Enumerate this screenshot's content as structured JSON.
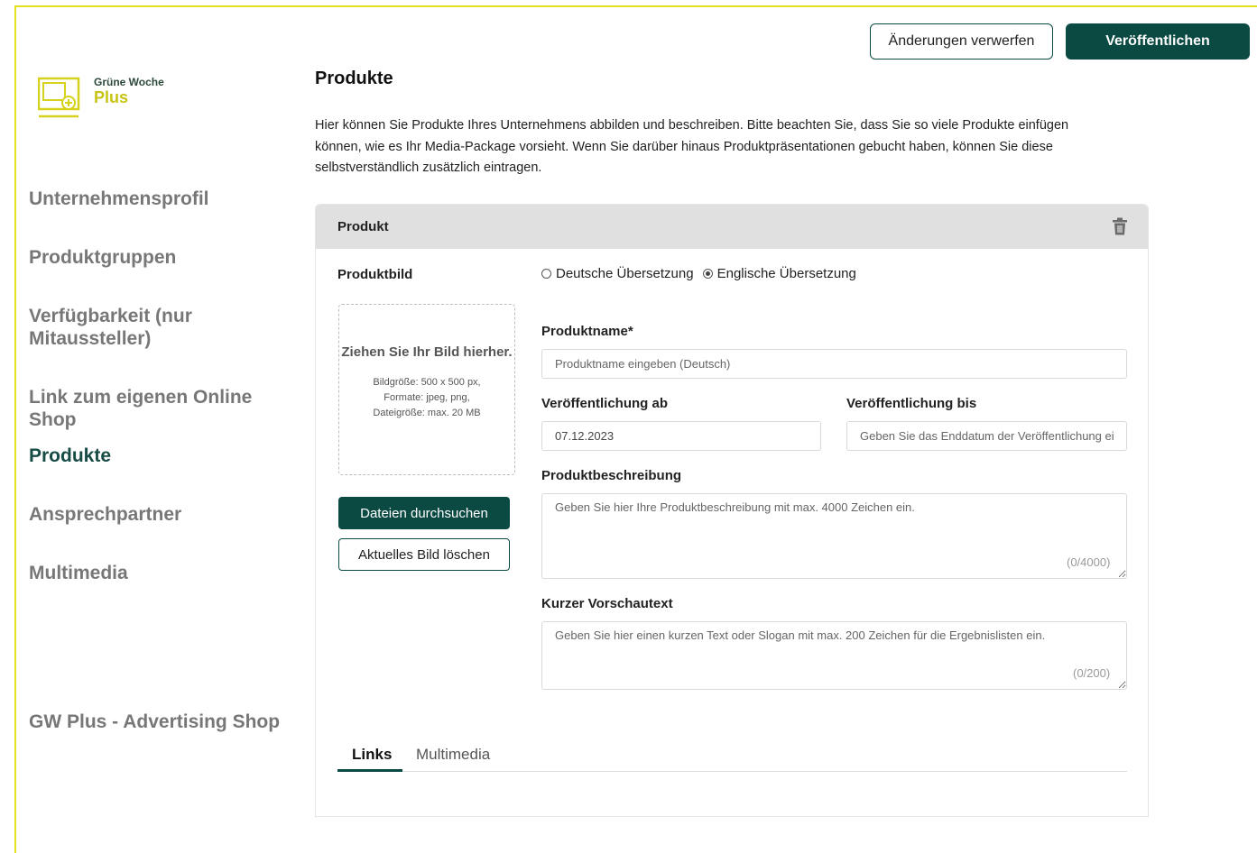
{
  "header": {
    "discard_label": "Änderungen verwerfen",
    "publish_label": "Veröffentlichen"
  },
  "logo": {
    "line1": "Grüne Woche",
    "line2": "Plus"
  },
  "sidebar": {
    "items": [
      {
        "label": "Unternehmensprofil"
      },
      {
        "label": "Produktgruppen"
      },
      {
        "label": "Verfügbarkeit (nur Mitaussteller)"
      },
      {
        "label": "Link zum eigenen Online Shop"
      },
      {
        "label": "Produkte"
      },
      {
        "label": "Ansprechpartner"
      },
      {
        "label": "Multimedia"
      }
    ],
    "active": "Produkte",
    "shop_link": "GW Plus - Advertising Shop"
  },
  "main": {
    "title": "Produkte",
    "intro": "Hier können Sie Produkte Ihres Unternehmens abbilden und beschreiben. Bitte beachten Sie, dass Sie so viele Produkte einfügen können, wie es Ihr Media-Package vorsieht. Wenn Sie darüber hinaus Produktpräsentationen gebucht haben, können Sie diese selbstverständlich zusätzlich eintragen."
  },
  "product": {
    "card_title": "Produkt",
    "image_label": "Produktbild",
    "language": {
      "options": [
        "Deutsche Übersetzung",
        "Englische Übersetzung"
      ],
      "selected": "Englische Übersetzung"
    },
    "dropzone": {
      "title": "Ziehen Sie Ihr Bild hierher.",
      "info": "Bildgröße: 500 x 500 px, Formate: jpeg, png, Dateigröße: max. 20 MB"
    },
    "browse_label": "Dateien durchsuchen",
    "delete_image_label": "Aktuelles Bild löschen",
    "name": {
      "label": "Produktname*",
      "placeholder": "Produktname eingeben (Deutsch)"
    },
    "publish_from": {
      "label": "Veröffentlichung ab",
      "value": "07.12.2023"
    },
    "publish_until": {
      "label": "Veröffentlichung bis",
      "placeholder": "Geben Sie das Enddatum der Veröffentlichung ein"
    },
    "description": {
      "label": "Produktbeschreibung",
      "placeholder": "Geben Sie hier Ihre Produktbeschreibung mit max. 4000 Zeichen ein.",
      "counter": "(0/4000)"
    },
    "preview": {
      "label": "Kurzer Vorschautext",
      "placeholder": "Geben Sie hier einen kurzen Text oder Slogan mit max. 200 Zeichen für die Ergebnislisten ein.",
      "counter": "(0/200)"
    },
    "tabs": [
      {
        "label": "Links"
      },
      {
        "label": "Multimedia"
      }
    ],
    "active_tab": "Links"
  },
  "colors": {
    "accent": "#0b4a43",
    "frame": "#e3e21f",
    "logo_yellow": "#c8c415"
  }
}
